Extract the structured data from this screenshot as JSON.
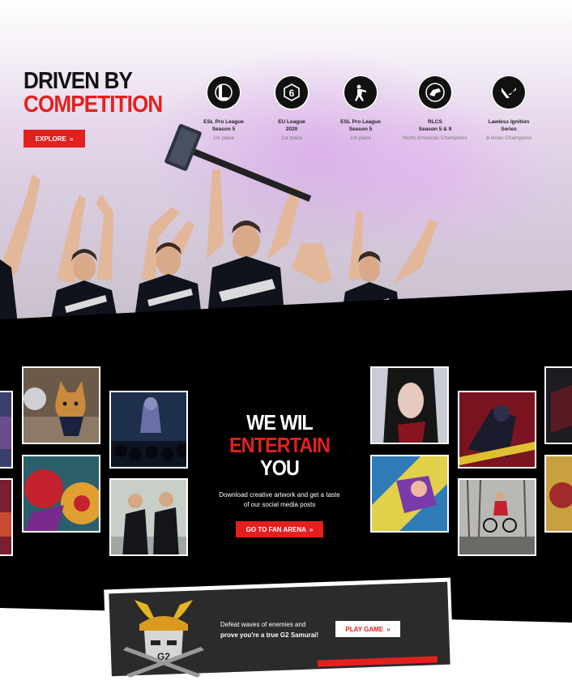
{
  "hero": {
    "title_line1": "DRIVEN BY",
    "title_line2": "COMPETITION",
    "explore_label": "EXPLORE",
    "arrow": "»"
  },
  "achievements": [
    {
      "icon": "league-of-legends-icon",
      "title_line1": "ESL Pro League",
      "title_line2": "Season 5",
      "result": "1st place"
    },
    {
      "icon": "rainbow-six-icon",
      "title_line1": "EU League",
      "title_line2": "2020",
      "result": "1st place"
    },
    {
      "icon": "counter-strike-icon",
      "title_line1": "ESL Pro League",
      "title_line2": "Season 5",
      "result": "1st place"
    },
    {
      "icon": "rocket-league-icon",
      "title_line1": "RLCS",
      "title_line2": "Season 5 & 9",
      "result": "North American Champions"
    },
    {
      "icon": "valorant-icon",
      "title_line1": "Lawless Ignition",
      "title_line2": "Series",
      "result": "8-times Champions"
    }
  ],
  "entertain": {
    "title_line1": "WE WIL",
    "title_red": "ENTERTAIN",
    "title_white": "YOU",
    "desc_line1": "Download creative artwork and get a taste",
    "desc_line2": "of our social media posts",
    "button_label": "GO TO FAN ARENA",
    "arrow": "»"
  },
  "promo": {
    "line1": "Defeat waves of enemies and",
    "line2": "prove you're a true G2 Samurai!",
    "button_label": "PLAY GAME",
    "arrow": "»"
  },
  "colors": {
    "accent": "#e4201e",
    "dark": "#000000",
    "promo_bg": "#2b2b2b"
  }
}
